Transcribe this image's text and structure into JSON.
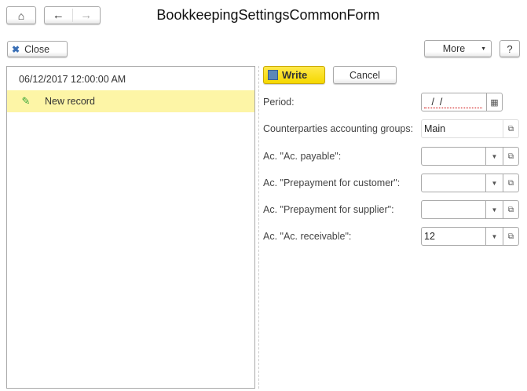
{
  "window": {
    "title": "BookkeepingSettingsCommonForm"
  },
  "toolbar": {
    "close_label": "Close",
    "more_label": "More",
    "help_label": "?"
  },
  "list": {
    "rows": [
      {
        "text": "06/12/2017 12:00:00 AM",
        "selected": false
      },
      {
        "text": "New record",
        "selected": true
      }
    ]
  },
  "form": {
    "write_label": "Write",
    "cancel_label": "Cancel",
    "fields": [
      {
        "label": "Period:",
        "value": " /  /"
      },
      {
        "label": "Counterparties accounting groups:",
        "value": "Main"
      },
      {
        "label": "Ac. \"Ac. payable\":",
        "value": ""
      },
      {
        "label": "Ac. \"Prepayment for customer\":",
        "value": ""
      },
      {
        "label": "Ac. \"Prepayment for supplier\":",
        "value": ""
      },
      {
        "label": "Ac. \"Ac. receivable\":",
        "value": "12"
      }
    ]
  },
  "colors": {
    "write": "#f5d800",
    "selected_row": "#fdf5a6"
  }
}
